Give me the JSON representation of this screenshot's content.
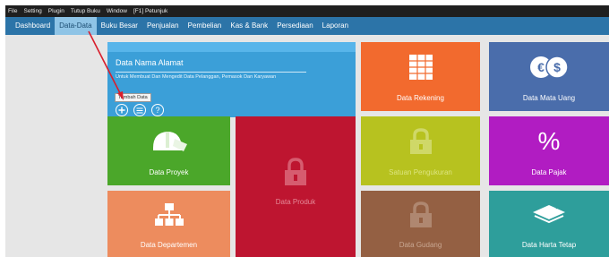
{
  "menubar": {
    "items": [
      "File",
      "Setting",
      "Plugin",
      "Tutup Buku",
      "Window",
      "[F1] Petunjuk"
    ]
  },
  "nav": {
    "tabs": [
      "Dashboard",
      "Data-Data",
      "Buku Besar",
      "Penjualan",
      "Pembelian",
      "Kas & Bank",
      "Persediaan",
      "Laporan"
    ],
    "active": "Data-Data"
  },
  "info_panel": {
    "title": "Data Nama Alamat",
    "description": "Untuk Membuat Dan Mengedit Data Pelanggan, Pemasok Dan Karyawan",
    "tooltip": "Tambah Data",
    "help_glyph": "?"
  },
  "tiles": {
    "rekening": "Data Rekening",
    "mata_uang": "Data Mata Uang",
    "proyek": "Data Proyek",
    "produk": "Data Produk",
    "satuan": "Satuan Pengukuran",
    "pajak": "Data Pajak",
    "departemen": "Data Departemen",
    "gudang": "Data Gudang",
    "harta_tetap": "Data Harta Tetap"
  },
  "colors": {
    "nav_bg": "#2c74a8",
    "active_tab": "#8fc4e6",
    "info": "#3b9fd8",
    "rekening": "#f26a2e",
    "mata_uang": "#4a6dab",
    "proyek": "#4ba72a",
    "produk": "#be1530",
    "satuan": "#b7c21f",
    "pajak": "#b11cc2",
    "departemen": "#ed8c5e",
    "gudang": "#946043",
    "harta_tetap": "#2e9e9b",
    "annotation_arrow": "#d81e2c"
  }
}
